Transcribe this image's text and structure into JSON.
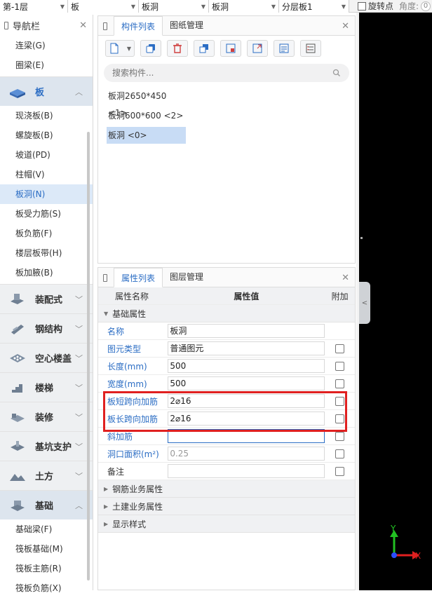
{
  "topbar": {
    "floor": "第-1层",
    "type": "板",
    "subtype": "板洞",
    "component": "板洞",
    "layer": "分层板1",
    "rotate_label": "旋转点",
    "angle_label": "角度:",
    "angle_value": "0"
  },
  "nav": {
    "title": "导航栏",
    "top_items": [
      {
        "label": "连梁(G)"
      },
      {
        "label": "圈梁(E)"
      }
    ],
    "open_category": "板",
    "open_items": [
      {
        "label": "现浇板(B)"
      },
      {
        "label": "螺旋板(B)"
      },
      {
        "label": "坡道(PD)"
      },
      {
        "label": "柱帽(V)"
      },
      {
        "label": "板洞(N)"
      },
      {
        "label": "板受力筋(S)"
      },
      {
        "label": "板负筋(F)"
      },
      {
        "label": "楼层板带(H)"
      },
      {
        "label": "板加腋(B)"
      }
    ],
    "categories": [
      {
        "label": "装配式"
      },
      {
        "label": "钢结构"
      },
      {
        "label": "空心楼盖"
      },
      {
        "label": "楼梯"
      },
      {
        "label": "装修"
      },
      {
        "label": "基坑支护"
      },
      {
        "label": "土方"
      }
    ],
    "foundation_category": "基础",
    "foundation_items": [
      {
        "label": "基础梁(F)"
      },
      {
        "label": "筏板基础(M)"
      },
      {
        "label": "筏板主筋(R)"
      },
      {
        "label": "筏板负筋(X)"
      }
    ]
  },
  "component_panel": {
    "tab_active": "构件列表",
    "tab_other": "图纸管理",
    "search_placeholder": "搜索构件...",
    "items": [
      {
        "label": "板洞2650*450 <1>"
      },
      {
        "label": "板洞600*600 <2>"
      },
      {
        "label": "板洞 <0>"
      }
    ]
  },
  "property_panel": {
    "tab_active": "属性列表",
    "tab_other": "图层管理",
    "headers": {
      "name": "属性名称",
      "value": "属性值",
      "extra": "附加"
    },
    "section_basic": "基础属性",
    "rows": [
      {
        "name": "名称",
        "value": "板洞"
      },
      {
        "name": "图元类型",
        "value": "普通图元"
      },
      {
        "name": "长度(mm)",
        "value": "500"
      },
      {
        "name": "宽度(mm)",
        "value": "500"
      },
      {
        "name": "板短跨向加筋",
        "value": "2⌀16"
      },
      {
        "name": "板长跨向加筋",
        "value": "2⌀16"
      },
      {
        "name": "斜加筋",
        "value": ""
      },
      {
        "name": "洞口面积(m²)",
        "value": "0.25"
      },
      {
        "name": "备注",
        "value": ""
      }
    ],
    "sections_collapsed": [
      {
        "label": "钢筋业务属性"
      },
      {
        "label": "土建业务属性"
      },
      {
        "label": "显示样式"
      }
    ]
  },
  "canvas": {
    "axis_y": "Y",
    "axis_x": "X"
  },
  "colors": {
    "accent": "#2b6dc4",
    "highlight": "#e02020",
    "axis_x": "#e02020",
    "axis_y": "#22c022"
  }
}
